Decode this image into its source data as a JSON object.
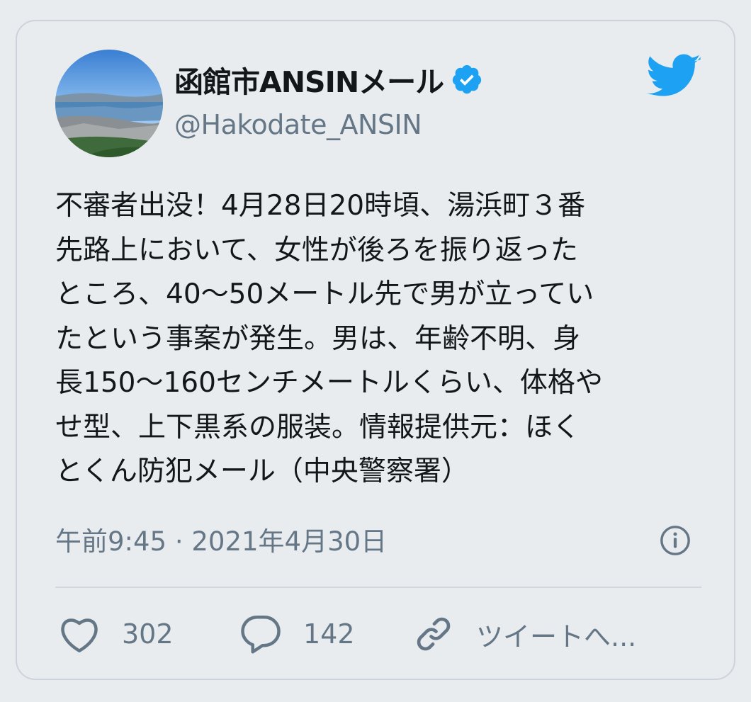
{
  "tweet": {
    "author": {
      "display_name": "函館市ANSINメール",
      "handle": "@Hakodate_ANSIN",
      "verified": true
    },
    "text": "不審者出没！4月28日20時頃、湯浜町３番\n先路上において、女性が後ろを振り返った\nところ、40〜50メートル先で男が立ってい\nたという事案が発生。男は、年齢不明、身\n長150〜160センチメートルくらい、体格や\nせ型、上下黒系の服装。情報提供元：ほく\nとくん防犯メール（中央警察署）",
    "timestamp": "午前9:45 · 2021年4月30日"
  },
  "actions": {
    "like_count": "302",
    "reply_count": "142",
    "share_label": "ツイートへ..."
  },
  "icons": {
    "brand": "twitter-bird-icon",
    "verified": "verified-badge-icon",
    "info": "info-icon",
    "like": "heart-icon",
    "reply": "reply-bubble-icon",
    "share": "link-icon"
  },
  "colors": {
    "brand_blue": "#1da1f2",
    "text_primary": "#14171a",
    "text_secondary": "#657786",
    "card_background": "#e8ecef",
    "card_border": "#cdd3da"
  }
}
